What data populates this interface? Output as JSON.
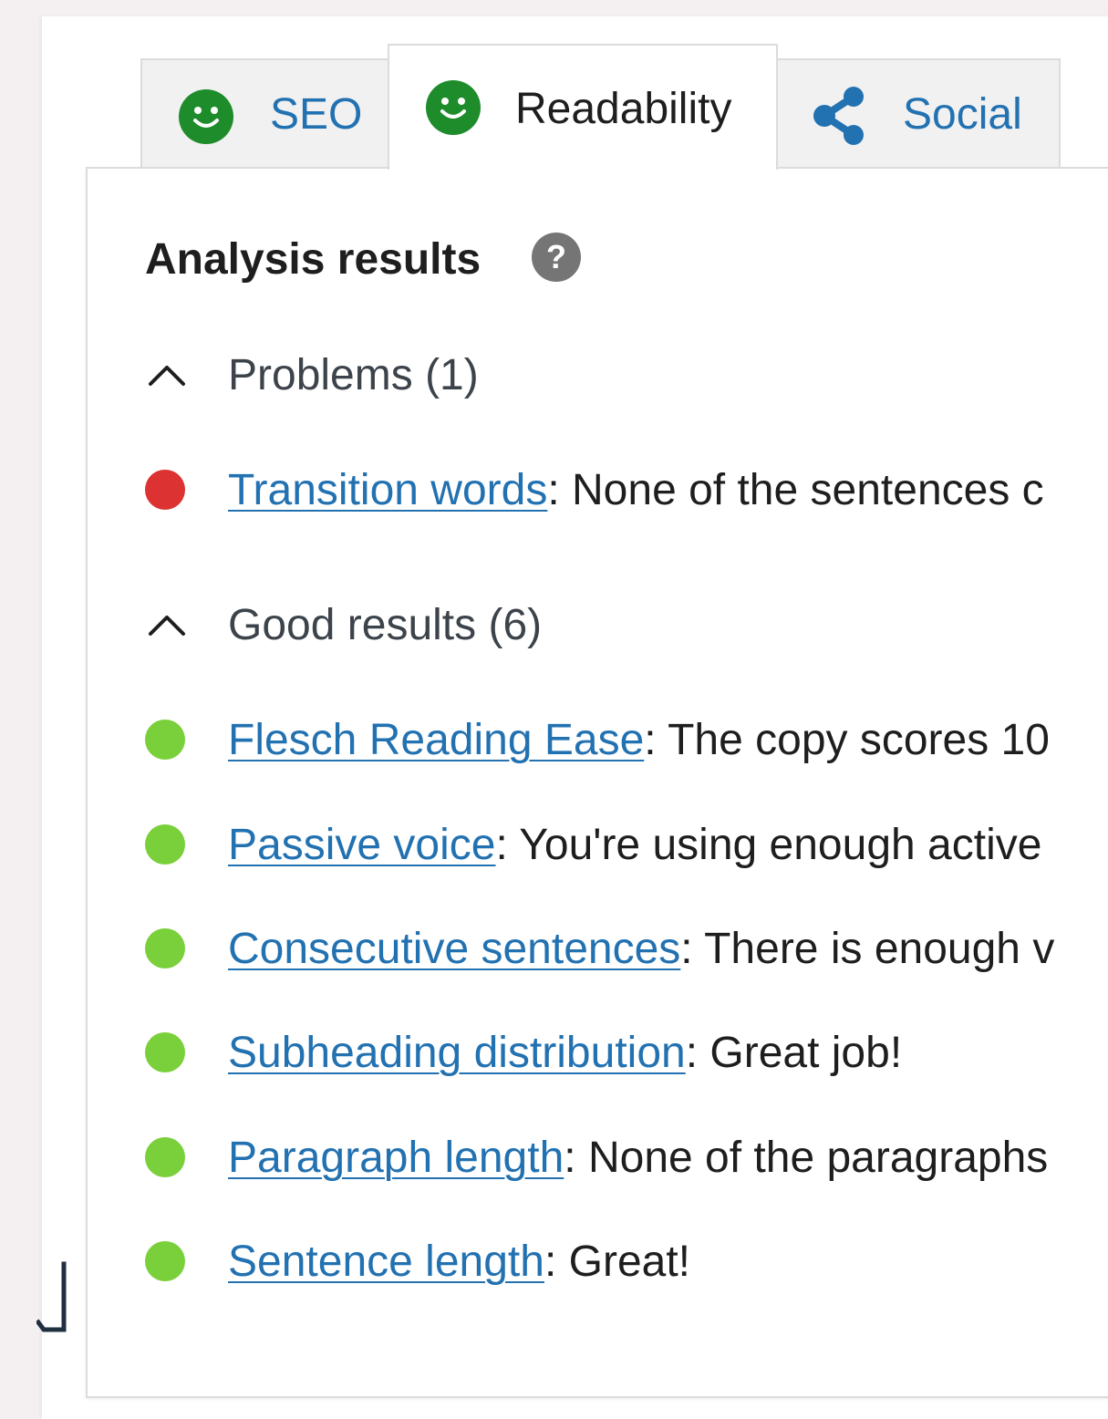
{
  "tabs": [
    {
      "label": "SEO",
      "icon": "smiley-face-icon",
      "active": false
    },
    {
      "label": "Readability",
      "icon": "smiley-face-icon",
      "active": true
    },
    {
      "label": "Social",
      "icon": "share-icon",
      "active": false
    }
  ],
  "analysis": {
    "heading": "Analysis results",
    "help_icon": "question-mark-icon",
    "problems": {
      "label": "Problems (1)",
      "items": [
        {
          "link": "Transition words",
          "text": ": None of the sentences c",
          "status": "bad"
        }
      ]
    },
    "good": {
      "label": "Good results (6)",
      "items": [
        {
          "link": "Flesch Reading Ease",
          "text": ": The copy scores 10",
          "status": "good"
        },
        {
          "link": "Passive voice",
          "text": ": You're using enough active",
          "status": "good"
        },
        {
          "link": "Consecutive sentences",
          "text": ": There is enough v",
          "status": "good"
        },
        {
          "link": "Subheading distribution",
          "text": ": Great job!",
          "status": "good"
        },
        {
          "link": "Paragraph length",
          "text": ": None of the paragraphs",
          "status": "good"
        },
        {
          "link": "Sentence length",
          "text": ": Great!",
          "status": "good"
        }
      ]
    }
  },
  "colors": {
    "link": "#2271b1",
    "good_bullet": "#7ad03a",
    "bad_bullet": "#dc3232",
    "smiley_green": "#1e8c2a",
    "share_blue": "#2271b1",
    "help_gray": "#757575"
  }
}
